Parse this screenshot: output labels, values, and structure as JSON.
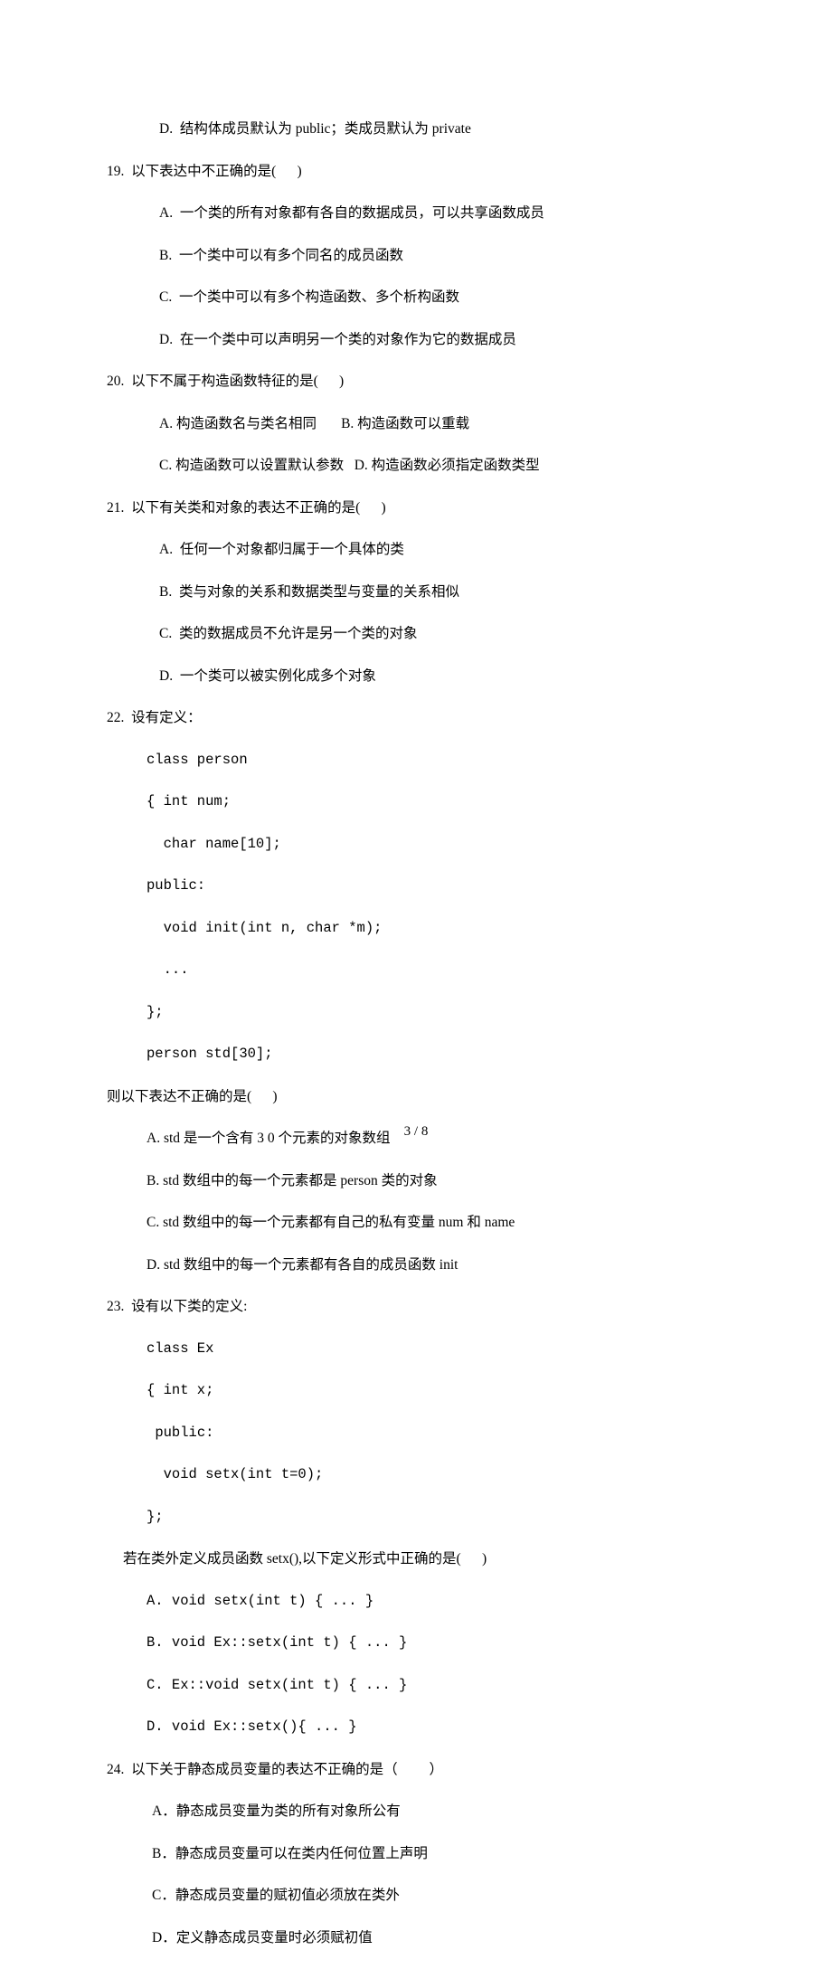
{
  "lines": {
    "l1": "D.  结构体成员默认为 public；类成员默认为 private",
    "l2": "19.  以下表达中不正确的是(      )",
    "l3": "A.  一个类的所有对象都有各自的数据成员，可以共享函数成员",
    "l4": "B.  一个类中可以有多个同名的成员函数",
    "l5": "C.  一个类中可以有多个构造函数、多个析构函数",
    "l6": "D.  在一个类中可以声明另一个类的对象作为它的数据成员",
    "l7": "20.  以下不属于构造函数特征的是(      )",
    "l8": "A. 构造函数名与类名相同       B. 构造函数可以重载",
    "l9": "C. 构造函数可以设置默认参数   D. 构造函数必须指定函数类型",
    "l10": "21.  以下有关类和对象的表达不正确的是(      )",
    "l11": "A.  任何一个对象都归属于一个具体的类",
    "l12": "B.  类与对象的关系和数据类型与变量的关系相似",
    "l13": "C.  类的数据成员不允许是另一个类的对象",
    "l14": "D.  一个类可以被实例化成多个对象",
    "l15": "22.  设有定义：",
    "l16": "class person",
    "l17": "{ int num;",
    "l18": "  char name[10];",
    "l19": "public:",
    "l20": "  void init(int n, char *m);",
    "l21": "  ...",
    "l22": "};",
    "l23": "person std[30];",
    "l24": "则以下表达不正确的是(      )",
    "l25": "A. std 是一个含有 3 0 个元素的对象数组",
    "l26": "B. std 数组中的每一个元素都是 person 类的对象",
    "l27": "C. std 数组中的每一个元素都有自己的私有变量 num 和 name",
    "l28": "D. std 数组中的每一个元素都有各自的成员函数 init",
    "l29": "23.  设有以下类的定义:",
    "l30": "class Ex",
    "l31": "{ int x;",
    "l32": " public:",
    "l33": "  void setx(int t=0);",
    "l34": "};",
    "l35": "若在类外定义成员函数 setx(),以下定义形式中正确的是(      )",
    "l36": "A. void setx(int t) { ... }",
    "l37": "B. void Ex::setx(int t) { ... }",
    "l38": "C. Ex::void setx(int t) { ... }",
    "l39": "D. void Ex::setx(){ ... }",
    "l40": "24.  以下关于静态成员变量的表达不正确的是（         ）",
    "l41": "A．静态成员变量为类的所有对象所公有",
    "l42": "B．静态成员变量可以在类内任何位置上声明",
    "l43": "C．静态成员变量的赋初值必须放在类外",
    "l44": "D．定义静态成员变量时必须赋初值"
  },
  "page_num": "3 / 8"
}
